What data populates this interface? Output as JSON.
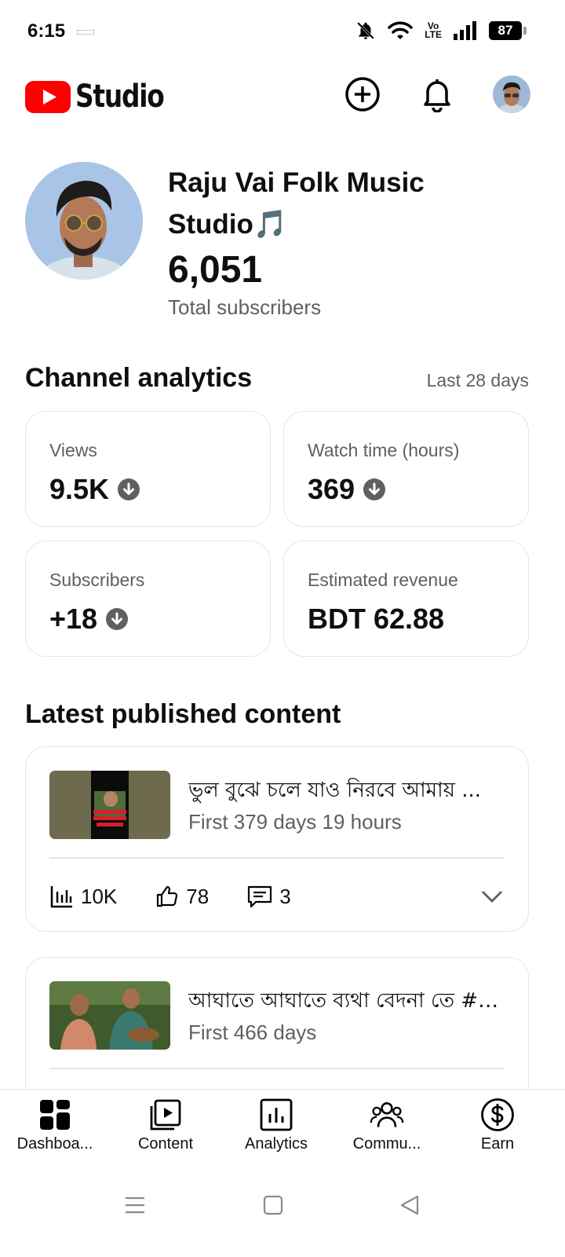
{
  "status_bar": {
    "time": "6:15",
    "battery": "87",
    "volte_top": "Vo",
    "volte_bottom": "LTE"
  },
  "header": {
    "app_name": "Studio",
    "brand_color": "#ff0000"
  },
  "channel": {
    "name": "Raju Vai Folk Music Studio🎵",
    "subscriber_count": "6,051",
    "subscriber_label": "Total subscribers"
  },
  "analytics": {
    "title": "Channel analytics",
    "range": "Last 28 days",
    "cards": [
      {
        "label": "Views",
        "value": "9.5K",
        "trend": "down"
      },
      {
        "label": "Watch time (hours)",
        "value": "369",
        "trend": "down"
      },
      {
        "label": "Subscribers",
        "value": "+18",
        "trend": "down"
      },
      {
        "label": "Estimated revenue",
        "value": "BDT 62.88",
        "trend": "none"
      }
    ]
  },
  "latest": {
    "title": "Latest published content",
    "items": [
      {
        "title": "ভুল বুঝে চলে যাও নিরবে আমায় ...",
        "age": "First 379 days 19 hours",
        "views": "10K",
        "likes": "78",
        "comments": "3"
      },
      {
        "title": "আঘাতে আঘাতে ব্যথা বেদনা তে #b...",
        "age": "First 466 days"
      }
    ]
  },
  "bottom_nav": [
    {
      "label": "Dashboa...",
      "icon": "dashboard-icon",
      "active": true
    },
    {
      "label": "Content",
      "icon": "content-icon"
    },
    {
      "label": "Analytics",
      "icon": "analytics-icon"
    },
    {
      "label": "Commu...",
      "icon": "community-icon"
    },
    {
      "label": "Earn",
      "icon": "earn-icon"
    }
  ]
}
